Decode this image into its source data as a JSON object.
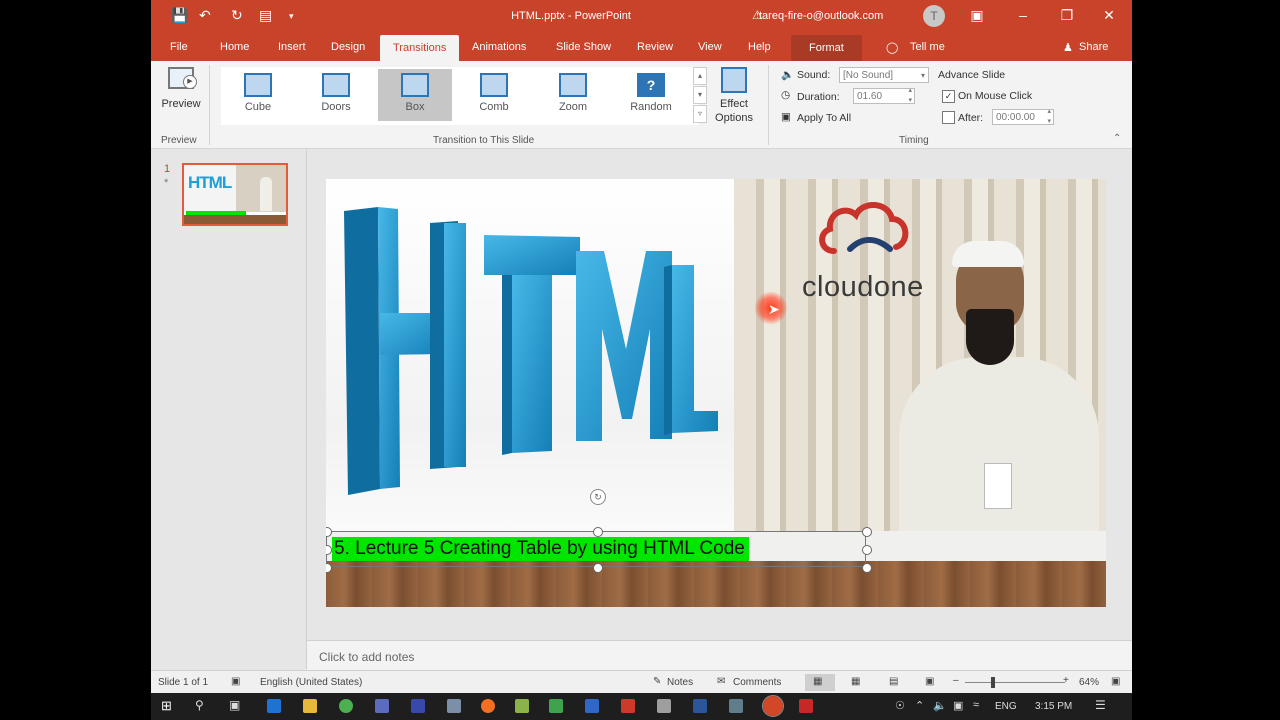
{
  "window": {
    "title": "HTML.pptx - PowerPoint",
    "account": "tareq-fire-o@outlook.com",
    "avatar_letter": "T"
  },
  "quick_access": {
    "save_icon": "save-icon",
    "undo_icon": "undo-icon",
    "redo_icon": "redo-icon",
    "present_icon": "present-icon",
    "more_icon": "chevron-down-icon"
  },
  "tabs": [
    "File",
    "Home",
    "Insert",
    "Design",
    "Transitions",
    "Animations",
    "Slide Show",
    "Review",
    "View",
    "Help",
    "Format"
  ],
  "tell_me": "Tell me",
  "share": "Share",
  "ribbon": {
    "preview_label": "Preview",
    "preview_group": "Preview",
    "gallery": [
      "Cube",
      "Doors",
      "Box",
      "Comb",
      "Zoom",
      "Random"
    ],
    "gallery_selected": "Box",
    "gallery_group": "Transition to This Slide",
    "effect_options": "Effect Options",
    "sound_label": "Sound:",
    "sound_value": "[No Sound]",
    "duration_label": "Duration:",
    "duration_value": "01.60",
    "apply_all": "Apply To All",
    "advance_title": "Advance Slide",
    "on_mouse_click": "On Mouse Click",
    "after_label": "After:",
    "after_value": "00:00.00",
    "timing_group": "Timing"
  },
  "thumbnail": {
    "number": "1",
    "star": "*"
  },
  "slide": {
    "html_word": "HTML",
    "logo_text": "cloudone",
    "caption": "5. Lecture 5 Creating Table by using HTML Code"
  },
  "notes_placeholder": "Click to add notes",
  "status": {
    "slide_count": "Slide 1 of 1",
    "language": "English (United States)",
    "notes": "Notes",
    "comments": "Comments",
    "zoom": "64%"
  },
  "taskbar": {
    "language": "ENG",
    "time": "3:15 PM"
  },
  "colors": {
    "accent": "#c9432b",
    "caption_bg": "#00e600",
    "html_blue": "#1f9fd6"
  }
}
